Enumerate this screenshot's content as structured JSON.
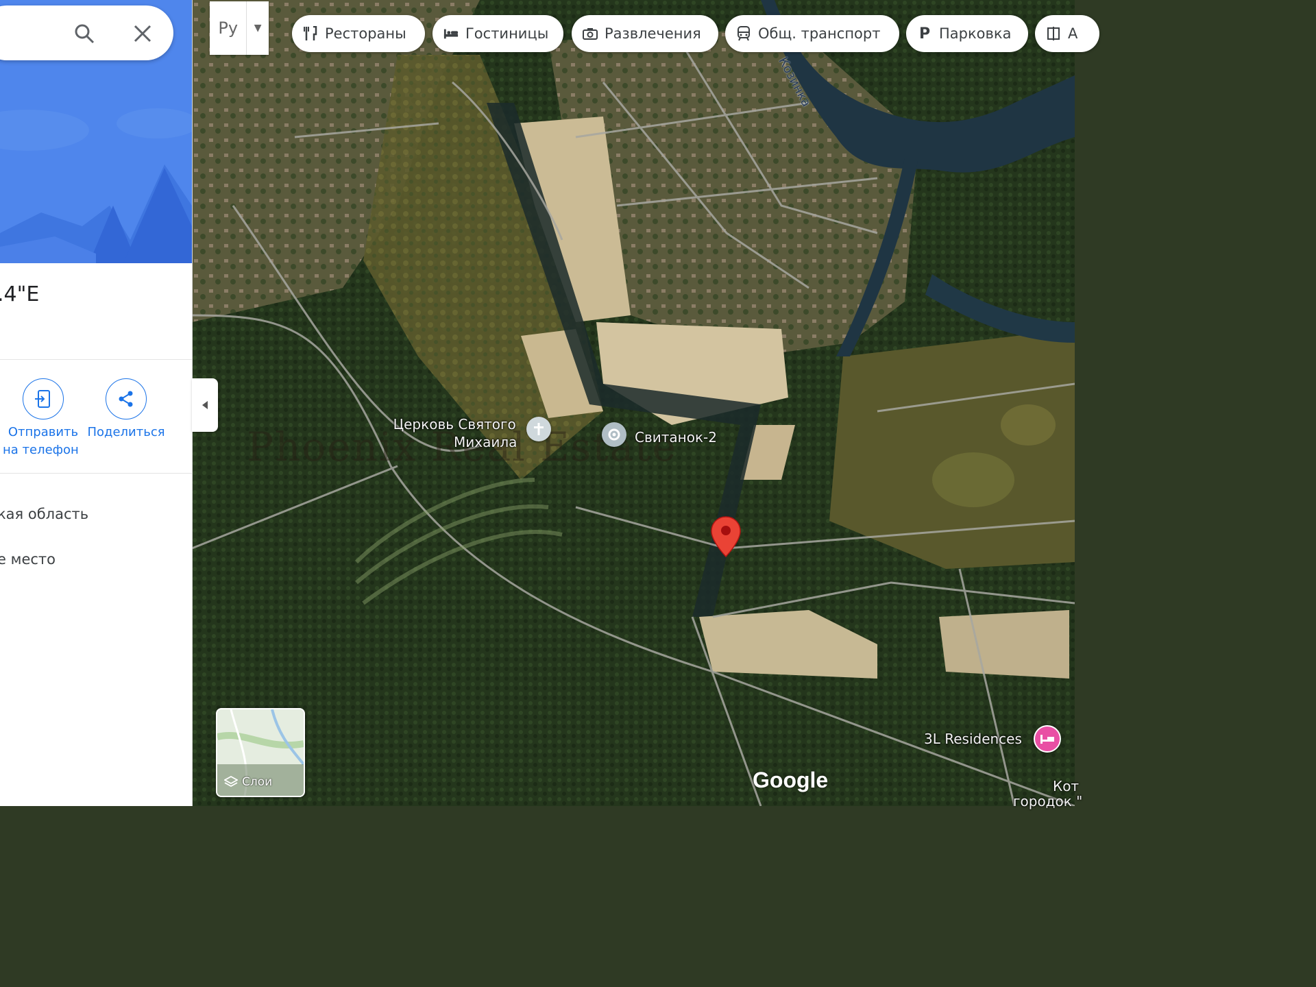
{
  "search": {
    "search_icon": "search-icon",
    "close_icon": "close-icon"
  },
  "panel": {
    "coordinates_fragment": ".4\"E",
    "actions": [
      {
        "label_line1": "Отправить",
        "label_line2": "на телефон",
        "icon": "send-to-phone-icon"
      },
      {
        "label_line1": "Поделиться",
        "label_line2": "",
        "icon": "share-icon"
      }
    ],
    "info_lines": [
      "кая область",
      "е место"
    ]
  },
  "map": {
    "language_button": "Ру",
    "chips": [
      {
        "label": "Рестораны",
        "icon": "restaurant-icon"
      },
      {
        "label": "Гостиницы",
        "icon": "hotel-icon"
      },
      {
        "label": "Развлечения",
        "icon": "camera-icon"
      },
      {
        "label": "Общ. транспорт",
        "icon": "transit-icon"
      },
      {
        "label": "Парковка",
        "icon": "parking-icon"
      },
      {
        "label": "А",
        "icon": "more-icon"
      }
    ],
    "labels": {
      "church_line1": "Церковь Святого",
      "church_line2": "Михаила",
      "place": "Свитанок-2",
      "river": "Козинка",
      "hotel": "3L Residences",
      "cottage_line1": "Кот",
      "cottage_line2": "городок \""
    },
    "watermark": "Phoenix Real Estate",
    "google_logo": "Google",
    "layers_label": "Слои"
  },
  "colors": {
    "panel_hero": "#4f86ec",
    "accent_blue": "#1a73e8",
    "pin_red": "#ea4335",
    "hotel_pink": "#e94fa4"
  }
}
